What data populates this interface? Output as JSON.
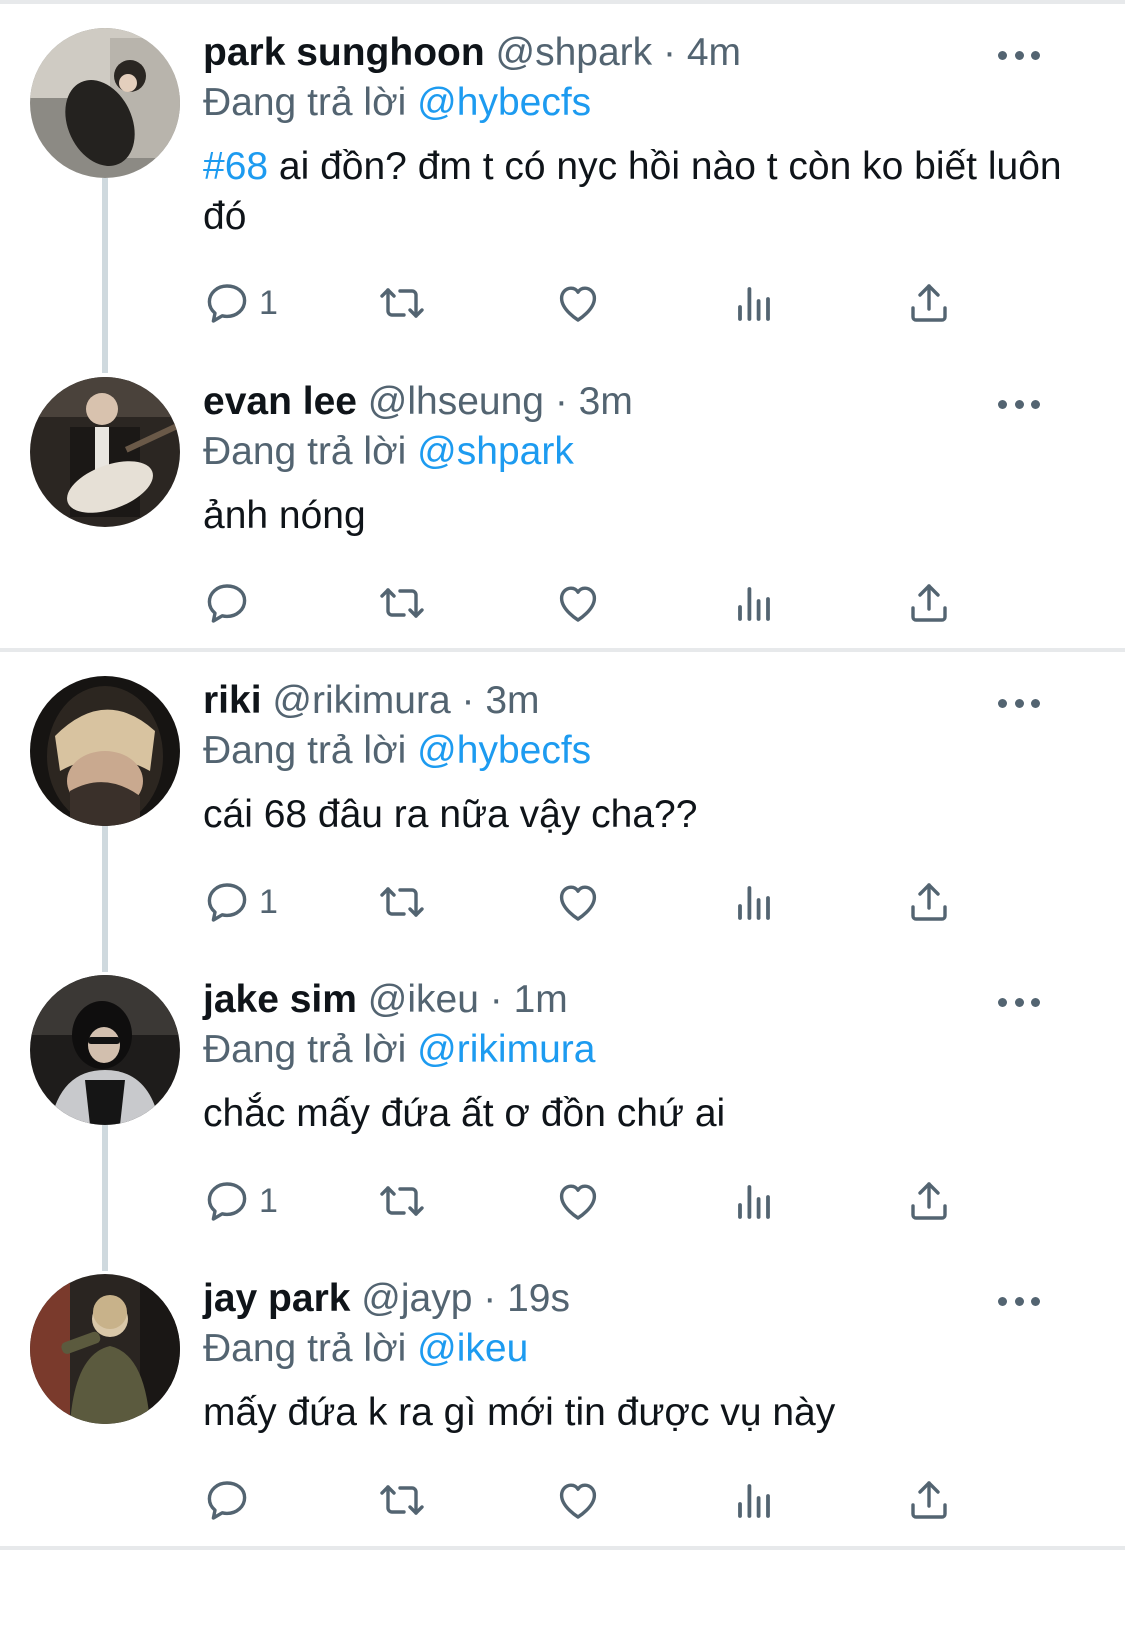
{
  "reply_prefix": "Đang trả lời",
  "colors": {
    "text": "#0f1419",
    "secondary": "#536471",
    "link": "#1d9bf0",
    "divider": "#e7e9eb",
    "thread_line": "#cfd9de"
  },
  "icons": [
    "reply-icon",
    "retweet-icon",
    "like-icon",
    "views-icon",
    "share-icon",
    "more-icon"
  ],
  "tweets": [
    {
      "name": "park sunghoon",
      "handle": "@shpark",
      "time": "· 4m",
      "replying_to": "@hybecfs",
      "hashtag": "#68",
      "text": " ai đồn? đm t có nyc hồi nào t còn ko biết luôn đó",
      "reply_count": "1"
    },
    {
      "name": "evan lee",
      "handle": "@lhseung",
      "time": "· 3m",
      "replying_to": "@shpark",
      "text": "ảnh nóng",
      "reply_count": ""
    },
    {
      "name": "riki",
      "handle": "@rikimura",
      "time": "· 3m",
      "replying_to": "@hybecfs",
      "text": "cái 68 đâu ra nữa vậy cha??",
      "reply_count": "1"
    },
    {
      "name": "jake sim",
      "handle": "@ikeu",
      "time": "· 1m",
      "replying_to": "@rikimura",
      "text": "chắc mấy đứa ất ơ đồn chứ ai",
      "reply_count": "1"
    },
    {
      "name": "jay park",
      "handle": "@jayp",
      "time": "· 19s",
      "replying_to": "@ikeu",
      "text": "mấy đứa k ra gì mới tin được vụ này",
      "reply_count": ""
    }
  ]
}
